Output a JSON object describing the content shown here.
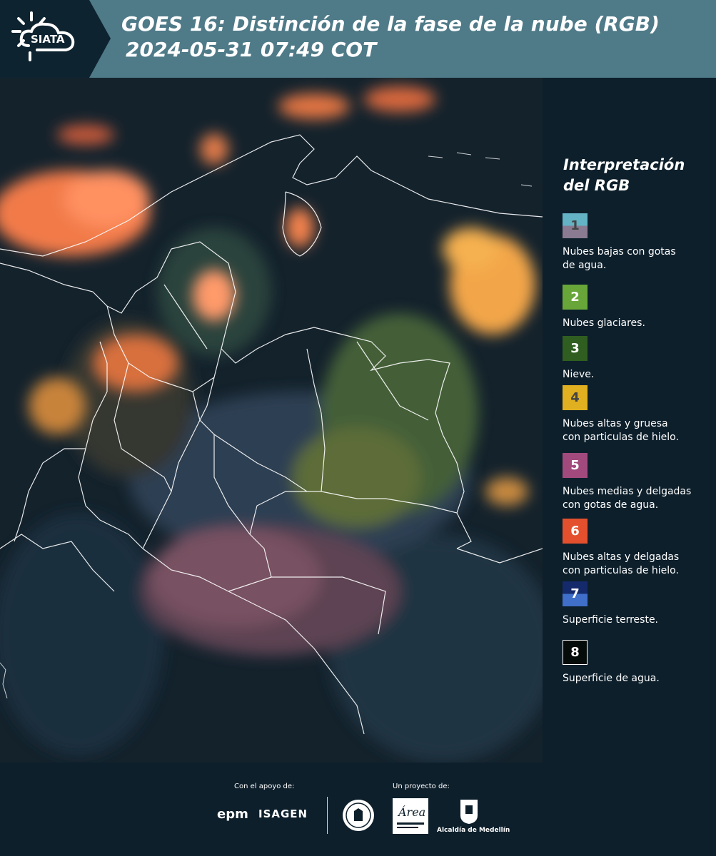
{
  "header": {
    "logo_text": "SIATA",
    "title_line1": "GOES 16: Distinción de la fase de la nube (RGB)",
    "title_line2": "2024-05-31 07:49 COT"
  },
  "legend": {
    "title": "Interpretación del RGB",
    "items": [
      {
        "number": "1",
        "label_line1": "Nubes bajas con gotas",
        "label_line2": "de agua.",
        "color_top": "#63b3c4",
        "color_bottom": "#8a7b93"
      },
      {
        "number": "2",
        "label_line1": "Nubes glaciares.",
        "label_line2": "",
        "color_top": "#69a63a",
        "color_bottom": "#69a63a"
      },
      {
        "number": "3",
        "label_line1": "Nieve.",
        "label_line2": "",
        "color_top": "#2f5e20",
        "color_bottom": "#2f5e20"
      },
      {
        "number": "4",
        "label_line1": "Nubes altas y gruesa",
        "label_line2": "con particulas de hielo.",
        "color_top": "#e0b020",
        "color_bottom": "#e0b020"
      },
      {
        "number": "5",
        "label_line1": "Nubes medias y delgadas",
        "label_line2": "con gotas de agua.",
        "color_top": "#a24a7e",
        "color_bottom": "#a24a7e"
      },
      {
        "number": "6",
        "label_line1": "Nubes altas y delgadas",
        "label_line2": "con particulas de hielo.",
        "color_top": "#e4502e",
        "color_bottom": "#e4502e"
      },
      {
        "number": "7",
        "label_line1": "Superficie terreste.",
        "label_line2": "",
        "color_top": "#142a6a",
        "color_bottom": "#3f6fc8"
      },
      {
        "number": "8",
        "label_line1": "Superficie de agua.",
        "label_line2": "",
        "color_top": "#050b08",
        "color_bottom": "#050b08"
      }
    ]
  },
  "footer": {
    "support_label": "Con el apoyo de:",
    "project_label": "Un proyecto de:",
    "epm_logo": "epm",
    "isagen_logo": "ISAGEN",
    "area_logo": "Área",
    "alcaldia_label": "Alcaldía de Medellín"
  }
}
